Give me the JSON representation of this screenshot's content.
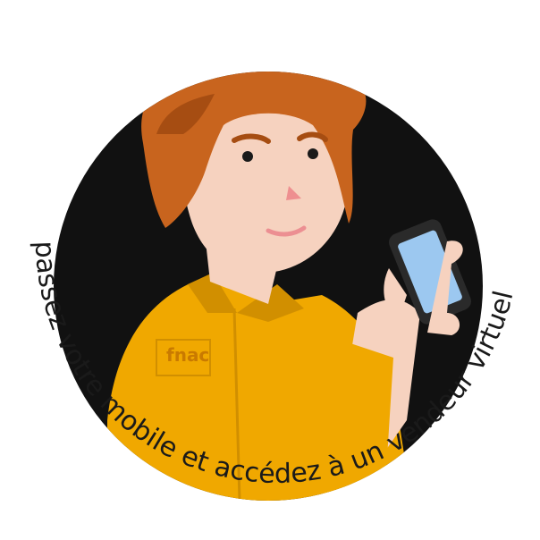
{
  "badge": {
    "curved_text": "passez  votre mobile et accédez à un vendeur virtuel",
    "logo_text": "fnac"
  },
  "colors": {
    "background": "#ffffff",
    "disc": "#111111",
    "shirt": "#f0a800",
    "shirt_shadow": "#d18f00",
    "hair": "#c8641e",
    "hair_dark": "#a64d12",
    "skin": "#f6d2bf",
    "phone_body": "#2a2a2a",
    "phone_screen": "#9cc8f0"
  }
}
